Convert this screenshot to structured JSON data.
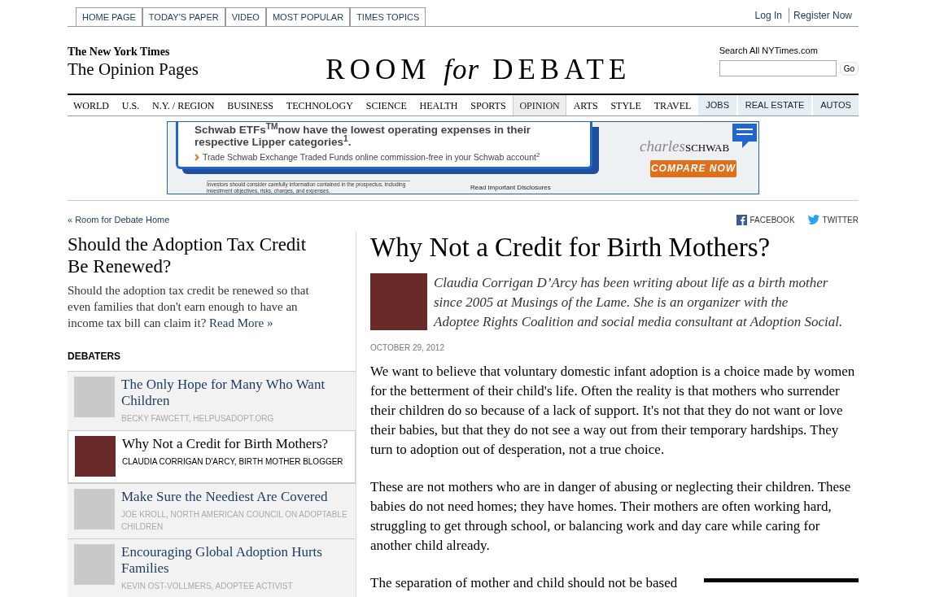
{
  "top_tabs": [
    {
      "label": "HOME PAGE"
    },
    {
      "label": "TODAY'S PAPER"
    },
    {
      "label": "VIDEO"
    },
    {
      "label": "MOST POPULAR"
    },
    {
      "label": "TIMES TOPICS"
    }
  ],
  "account_links": [
    {
      "label": "Log In"
    },
    {
      "label": "Register Now"
    }
  ],
  "masthead": {
    "publisher": "The New York Times",
    "section": "The Opinion Pages",
    "title_parts": [
      {
        "text": "ROOM",
        "italic": false
      },
      {
        "text": "for",
        "italic": true
      },
      {
        "text": "DEBATE",
        "italic": false
      }
    ]
  },
  "search": {
    "label": "Search All NYTimes.com",
    "button": "Go"
  },
  "section_nav": [
    {
      "label": "WORLD",
      "selected": false,
      "kind": "section"
    },
    {
      "label": "U.S.",
      "selected": false,
      "kind": "section"
    },
    {
      "label": "N.Y. / REGION",
      "selected": false,
      "kind": "section"
    },
    {
      "label": "BUSINESS",
      "selected": false,
      "kind": "section"
    },
    {
      "label": "TECHNOLOGY",
      "selected": false,
      "kind": "section"
    },
    {
      "label": "SCIENCE",
      "selected": false,
      "kind": "section"
    },
    {
      "label": "HEALTH",
      "selected": false,
      "kind": "section"
    },
    {
      "label": "SPORTS",
      "selected": false,
      "kind": "section"
    },
    {
      "label": "OPINION",
      "selected": true,
      "kind": "section"
    },
    {
      "label": "ARTS",
      "selected": false,
      "kind": "section"
    },
    {
      "label": "STYLE",
      "selected": false,
      "kind": "section"
    },
    {
      "label": "TRAVEL",
      "selected": false,
      "kind": "section"
    },
    {
      "label": "JOBS",
      "selected": false,
      "kind": "classified"
    },
    {
      "label": "REAL ESTATE",
      "selected": false,
      "kind": "classified"
    },
    {
      "label": "AUTOS",
      "selected": false,
      "kind": "classified"
    }
  ],
  "ad": {
    "headline": "Schwab ETFs$^{TM}$now have the lowest operating expenses in their respective Lipper categories$^{1}$.",
    "subline": "Trade Schwab Exchange Traded Funds online commission-free in your Schwab account$^{2}$",
    "disclaimer": "Investors should consider carefully information contained in the prospectus, including investment objectives, risks, charges, and expenses.",
    "disclosures_link": "Read Important Disclosures",
    "brand_script": "charles",
    "brand": "SCHWAB",
    "cta": "COMPARE NOW"
  },
  "home_link": "« Room for Debate Home",
  "share": [
    {
      "label": "FACEBOOK",
      "kind": "facebook"
    },
    {
      "label": "TWITTER",
      "kind": "twitter"
    }
  ],
  "debate": {
    "question": "Should the Adoption Tax Credit Be Renewed?",
    "summary": "Should the adoption tax credit be renewed so that even families that don't earn enough to have an income tax bill can claim it?",
    "read_more": "Read More »"
  },
  "debaters_heading": "DEBATERS",
  "debaters": [
    {
      "title": "The Only Hope for Many Who Want Children",
      "byline": "BECKY FAWCETT, HELPUSADOPT.ORG",
      "selected": false
    },
    {
      "title": "Why Not a Credit for Birth Mothers?",
      "byline": "CLAUDIA CORRIGAN D'ARCY, BIRTH MOTHER BLOGGER",
      "selected": true
    },
    {
      "title": "Make Sure the Neediest Are Covered",
      "byline": "JOE KROLL, NORTH AMERICAN COUNCIL ON ADOPTABLE CHILDREN",
      "selected": false
    },
    {
      "title": "Encouraging Global Adoption Hurts Families",
      "byline": "KEVIN OST-VOLLMERS, ADOPTEE ACTIVIST",
      "selected": false
    }
  ],
  "article": {
    "title": "Why Not a Credit for Birth Mothers?",
    "bio": [
      {
        "kind": "text",
        "text": "Claudia Corrigan D’Arcy has been writing about life as a birth mother since 2005 at "
      },
      {
        "kind": "link",
        "text": "Musings of the Lame."
      },
      {
        "kind": "text",
        "text": " She is an organizer with the "
      },
      {
        "kind": "link",
        "text": "Adoptee Rights Coalition "
      },
      {
        "kind": "text",
        "text": "and social media consultant at "
      },
      {
        "kind": "link",
        "text": "Adoption Social"
      },
      {
        "kind": "text",
        "text": "."
      }
    ],
    "date": "OCTOBER 29, 2012",
    "paragraphs": [
      "We want to believe that voluntary domestic infant adoption is a choice made by women for the betterment of their child's life. Often the reality is that mothers who surrender their children do so because of a lack of support. It's not that they do not want or love their babies, but that they do not see a way out from their temporary hardships. They turn to adoption out of desperation, not a true choice.",
      "These are not mothers who are in danger of abusing or neglecting their children. These babies do not need homes; they have homes. Their mothers are often working hard, struggling to get through school, or balancing work and day care while caring for another child already.",
      "The separation of mother and child should not be based"
    ]
  }
}
